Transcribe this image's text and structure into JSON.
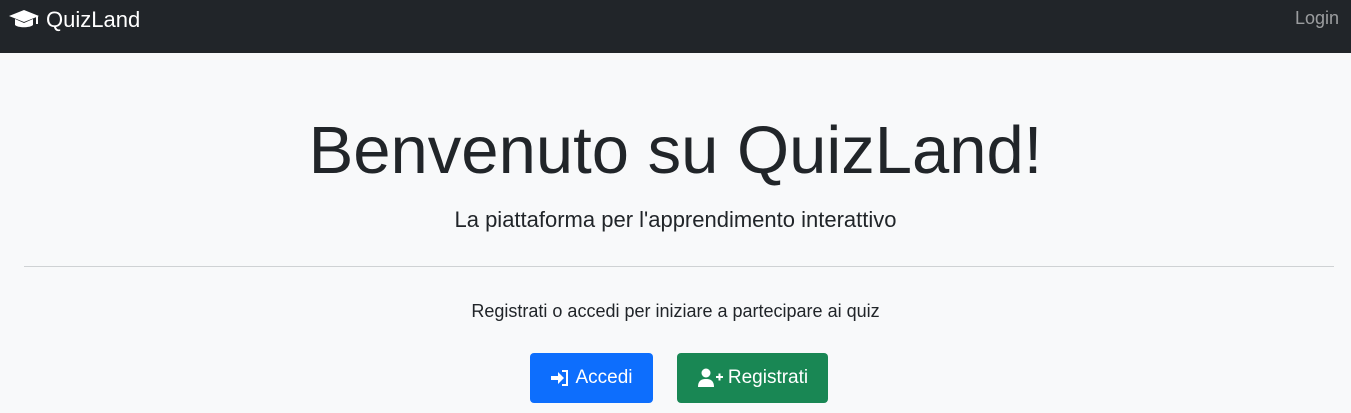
{
  "navbar": {
    "brand_icon": "graduation-cap-icon",
    "brand_label": "QuizLand",
    "login_label": "Login"
  },
  "hero": {
    "title": "Benvenuto su QuizLand!",
    "subtitle": "La piattaforma per l'apprendimento interattivo",
    "lead": "Registrati o accedi per iniziare a partecipare ai quiz"
  },
  "actions": {
    "login": {
      "label": "Accedi",
      "icon": "sign-in-icon"
    },
    "register": {
      "label": "Registrati",
      "icon": "user-plus-icon"
    }
  },
  "colors": {
    "navbar": "#212529",
    "page_background": "#f8f9fa",
    "primary": "#0d6efd",
    "success": "#198754"
  }
}
